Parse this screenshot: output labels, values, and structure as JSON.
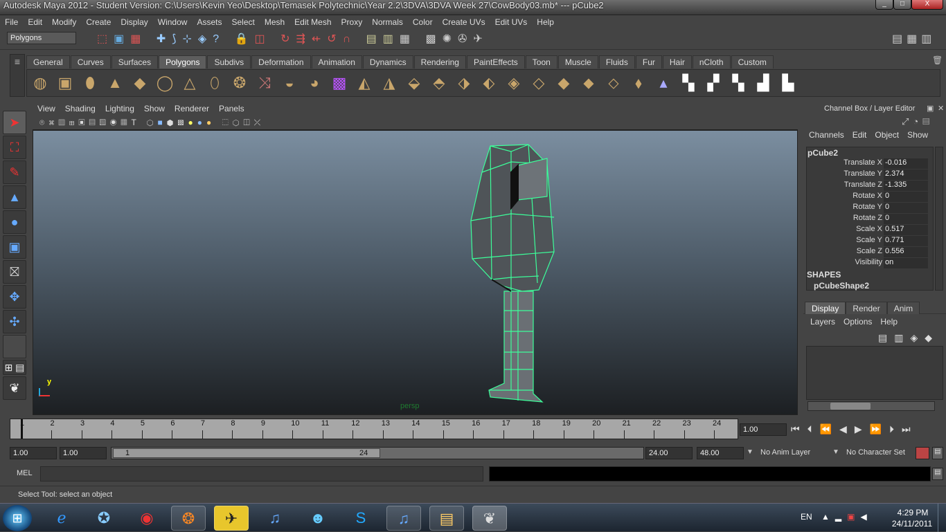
{
  "window": {
    "title": "Autodesk Maya 2012 - Student Version: C:\\Users\\Kevin Yeo\\Desktop\\Temasek Polytechnic\\Year 2.2\\3DVA\\3DVA Week 27\\CowBody03.mb*   ---   pCube2",
    "min": "_",
    "max": "□",
    "close": "X"
  },
  "menubar": [
    "File",
    "Edit",
    "Modify",
    "Create",
    "Display",
    "Window",
    "Assets",
    "Select",
    "Mesh",
    "Edit Mesh",
    "Proxy",
    "Normals",
    "Color",
    "Create UVs",
    "Edit UVs",
    "Help"
  ],
  "status": {
    "menu_set": "Polygons"
  },
  "shelf": {
    "tabs": [
      "General",
      "Curves",
      "Surfaces",
      "Polygons",
      "Subdivs",
      "Deformation",
      "Animation",
      "Dynamics",
      "Rendering",
      "PaintEffects",
      "Toon",
      "Muscle",
      "Fluids",
      "Fur",
      "Hair",
      "nCloth",
      "Custom"
    ],
    "active": "Polygons"
  },
  "viewport": {
    "menu": [
      "View",
      "Shading",
      "Lighting",
      "Show",
      "Renderer",
      "Panels"
    ],
    "camera": "persp",
    "axis_y": "y"
  },
  "channel_box": {
    "header": "Channel Box / Layer Editor",
    "menu": [
      "Channels",
      "Edit",
      "Object",
      "Show"
    ],
    "object": "pCube2",
    "attrs": [
      {
        "name": "Translate X",
        "value": "-0.016"
      },
      {
        "name": "Translate Y",
        "value": "2.374"
      },
      {
        "name": "Translate Z",
        "value": "-1.335"
      },
      {
        "name": "Rotate X",
        "value": "0"
      },
      {
        "name": "Rotate Y",
        "value": "0"
      },
      {
        "name": "Rotate Z",
        "value": "0"
      },
      {
        "name": "Scale X",
        "value": "0.517"
      },
      {
        "name": "Scale Y",
        "value": "0.771"
      },
      {
        "name": "Scale Z",
        "value": "0.556"
      },
      {
        "name": "Visibility",
        "value": "on"
      }
    ],
    "shapes_label": "SHAPES",
    "shape_name": "pCubeShape2"
  },
  "layer_editor": {
    "tabs": [
      "Display",
      "Render",
      "Anim"
    ],
    "active": "Display",
    "menu": [
      "Layers",
      "Options",
      "Help"
    ]
  },
  "timeline": {
    "ticks": [
      "1",
      "2",
      "3",
      "4",
      "5",
      "6",
      "7",
      "8",
      "9",
      "10",
      "11",
      "12",
      "13",
      "14",
      "15",
      "16",
      "17",
      "18",
      "19",
      "20",
      "21",
      "22",
      "23",
      "24"
    ],
    "current_frame": "1.00"
  },
  "range": {
    "start": "1.00",
    "playback_start": "1.00",
    "slider_start": "1",
    "slider_end": "24",
    "playback_end": "24.00",
    "end": "48.00",
    "anim_layer": "No Anim Layer",
    "char_set": "No Character Set"
  },
  "command_line": {
    "label": "MEL"
  },
  "help_line": "Select Tool: select an object",
  "taskbar": {
    "language": "EN",
    "time": "4:29 PM",
    "date": "24/11/2011"
  }
}
